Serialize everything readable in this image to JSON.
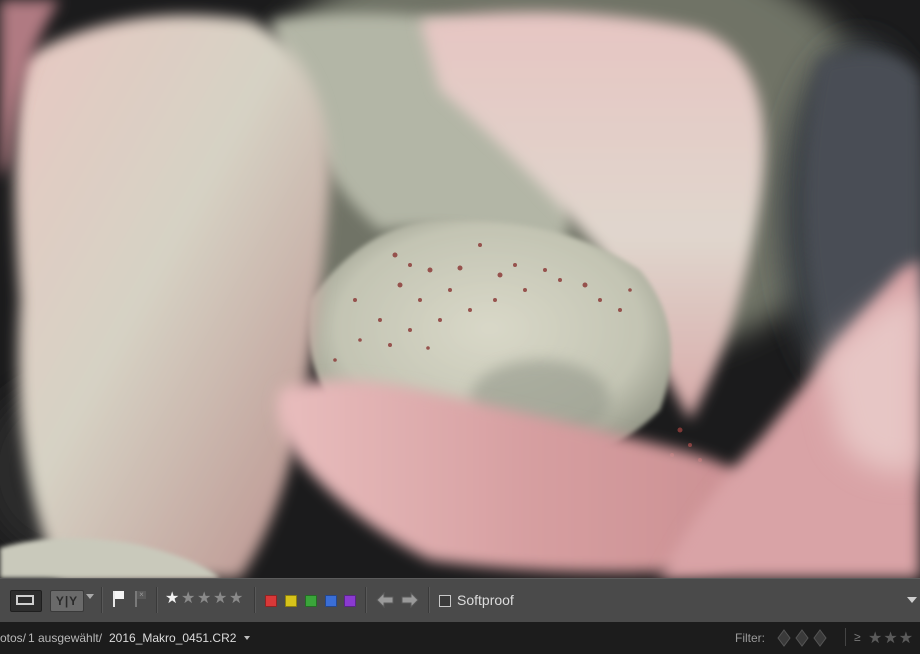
{
  "toolbar": {
    "softproof_label": "Softproof",
    "softproof_checked": false,
    "stars_total": 5,
    "color_labels": [
      "#d93838",
      "#d6c31a",
      "#3aa53a",
      "#3a6ed6",
      "#8a3ad0"
    ]
  },
  "filmstrip": {
    "path_prefix": "otos/",
    "selection": "1 ausgewählt/",
    "filename": "2016_Makro_0451.CR2",
    "filter_label": "Filter:",
    "filter_compare": "≥"
  },
  "colors": {
    "toolbar_bg": "#4a4a4a",
    "filmstrip_bg": "#1c1c1c",
    "text_light": "#dcdcdc"
  }
}
